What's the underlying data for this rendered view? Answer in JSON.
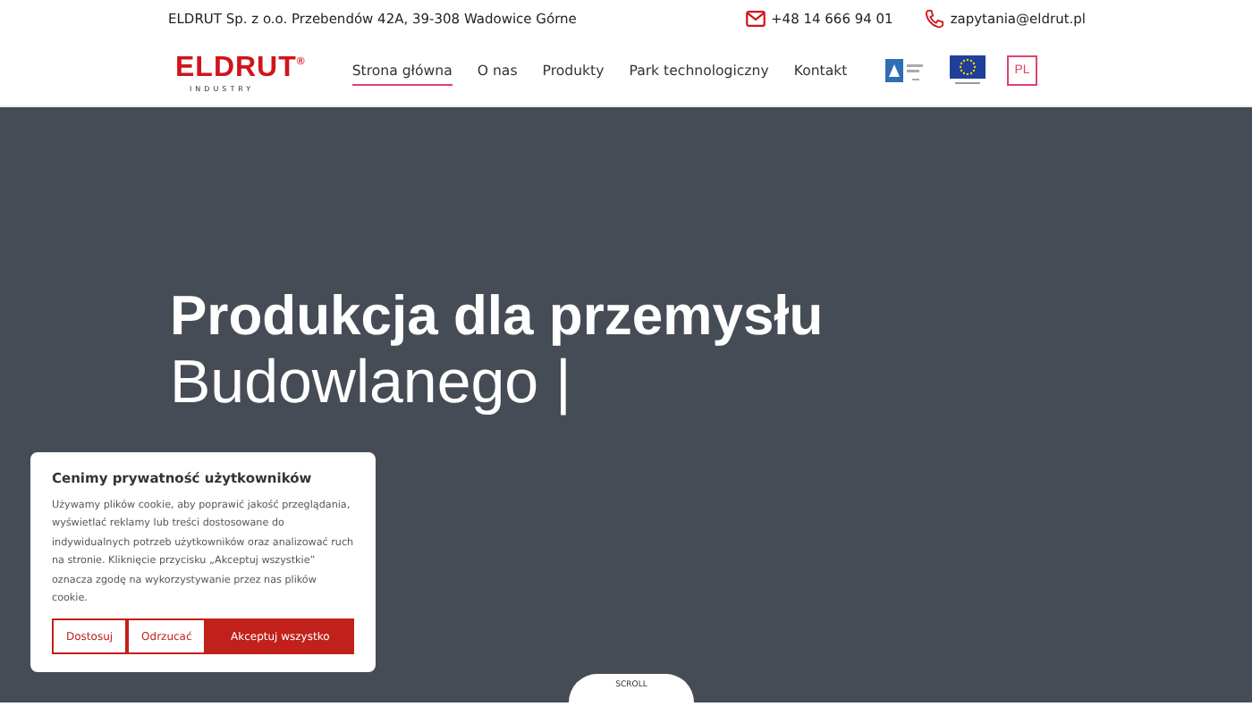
{
  "topbar": {
    "address": "ELDRUT Sp. z o.o. Przebendów 42A, 39-308 Wadowice Górne",
    "phone": "+48 14 666 94 01",
    "email": "zapytania@eldrut.pl"
  },
  "logo": {
    "name": "ELDRUT",
    "mark": "®",
    "tagline": "INDUSTRY"
  },
  "nav": [
    {
      "label": "Strona główna",
      "selected": true
    },
    {
      "label": "O nas",
      "selected": false
    },
    {
      "label": "Produkty",
      "selected": false
    },
    {
      "label": "Park technologiczny",
      "selected": false
    },
    {
      "label": "Kontakt",
      "selected": false
    }
  ],
  "language": "PL",
  "hero": {
    "title": "Produkcja dla przemysłu",
    "subtitle": "Budowlanego |",
    "scroll": "SCROLL"
  },
  "cookie": {
    "title": "Cenimy prywatność użytkowników",
    "body": "Używamy plików cookie, aby poprawić jakość przeglądania, wyświetlać reklamy lub treści dostosowane do indywidualnych potrzeb użytkowników oraz analizować ruch na stronie. Kliknięcie przycisku „Akceptuj wszystkie” oznacza zgodę na wykorzystywanie przez nas plików cookie.",
    "buttons": [
      {
        "label": "Dostosuj",
        "kind": "outline"
      },
      {
        "label": "Odrzucać",
        "kind": "outline"
      },
      {
        "label": "Akceptuj wszystko",
        "kind": "primary"
      }
    ]
  }
}
